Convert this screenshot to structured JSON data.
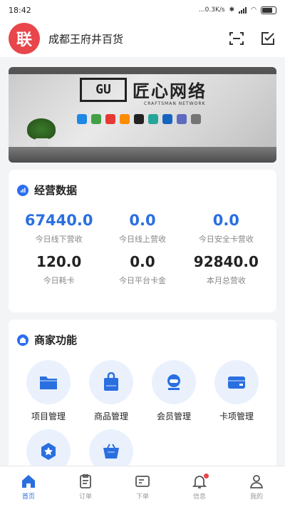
{
  "status_bar": {
    "time": "18:42",
    "network_speed": "...0.3K/s",
    "battery_icon": "battery-icon"
  },
  "header": {
    "logo_text": "联",
    "store_name": "成都王府井百货",
    "scan_icon": "scan-icon",
    "edit_icon": "edit-checklist-icon"
  },
  "banner": {
    "logo_box": "GU",
    "title": "匠心网络",
    "subtitle": "CRAFTSMAN NETWORK"
  },
  "business_data": {
    "title": "经营数据",
    "stats": [
      {
        "value": "67440.0",
        "label": "今日线下营收",
        "highlight": true
      },
      {
        "value": "0.0",
        "label": "今日线上营收",
        "highlight": true
      },
      {
        "value": "0.0",
        "label": "今日安全卡营收",
        "highlight": true
      },
      {
        "value": "120.0",
        "label": "今日耗卡",
        "highlight": false
      },
      {
        "value": "0.0",
        "label": "今日平台卡金",
        "highlight": false
      },
      {
        "value": "92840.0",
        "label": "本月总营收",
        "highlight": false
      }
    ]
  },
  "merchant_functions": {
    "title": "商家功能",
    "items": [
      {
        "label": "项目管理",
        "icon": "folder-icon"
      },
      {
        "label": "商品管理",
        "icon": "shopping-bag-icon"
      },
      {
        "label": "会员管理",
        "icon": "member-icon"
      },
      {
        "label": "卡项管理",
        "icon": "wallet-card-icon"
      },
      {
        "label": "",
        "icon": "star-badge-icon"
      },
      {
        "label": "",
        "icon": "basket-icon"
      }
    ]
  },
  "tabbar": {
    "items": [
      {
        "label": "首页",
        "icon": "home-icon",
        "active": true
      },
      {
        "label": "订单",
        "icon": "order-clipboard-icon",
        "active": false
      },
      {
        "label": "下单",
        "icon": "place-order-icon",
        "active": false
      },
      {
        "label": "信息",
        "icon": "bell-icon",
        "active": false
      },
      {
        "label": "我的",
        "icon": "user-icon",
        "active": false
      }
    ]
  },
  "colors": {
    "accent": "#2a6fe0",
    "logo_red": "#e8464a",
    "func_bg": "#eaf1fd"
  }
}
